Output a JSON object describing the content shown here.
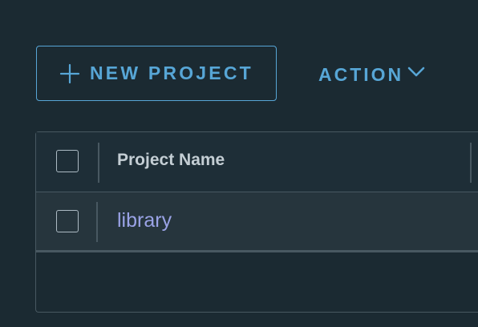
{
  "toolbar": {
    "new_project_label": "NEW PROJECT",
    "action_label": "ACTION",
    "plus_icon": "plus-icon",
    "chevron_icon": "chevron-down-icon"
  },
  "datagrid": {
    "columns": [
      {
        "label": "Project Name"
      }
    ],
    "rows": [
      {
        "project_name": "library"
      }
    ]
  },
  "colors": {
    "background": "#1b2a32",
    "accent": "#57a6d6",
    "link": "#9aa3e6",
    "border": "#485861"
  }
}
